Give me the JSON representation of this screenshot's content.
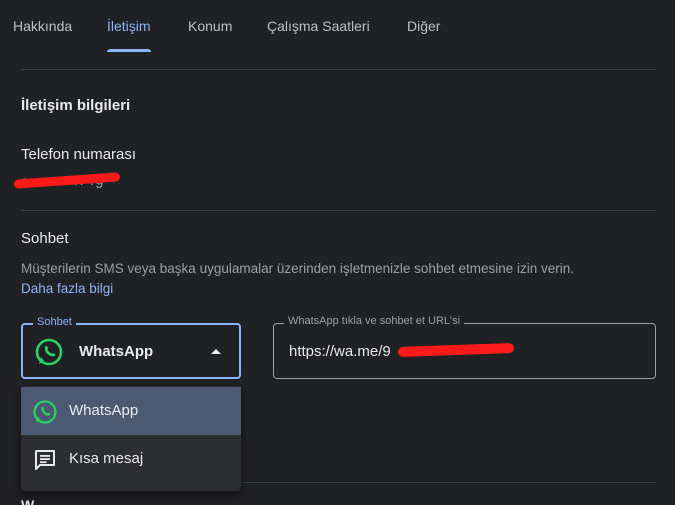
{
  "tabs": [
    {
      "label": "Hakkında"
    },
    {
      "label": "İletişim"
    },
    {
      "label": "Konum"
    },
    {
      "label": "Çalışma Saatleri"
    },
    {
      "label": "Diğer"
    }
  ],
  "active_tab": "İletişim",
  "contact": {
    "section_title": "İletişim bilgileri",
    "phone_label": "Telefon numarası",
    "phone_value": "0··· ··· ·· ·9"
  },
  "chat": {
    "title": "Sohbet",
    "description": "Müşterilerin SMS veya başka uygulamalar üzerinden işletmenizle sohbet etmesine izin verin.",
    "learn_more": "Daha fazla bilgi",
    "select_legend": "Sohbet",
    "selected_value": "WhatsApp",
    "url_legend": "WhatsApp tıkla ve sohbet et URL'si",
    "url_value": "https://wa.me/9",
    "options": [
      {
        "label": "WhatsApp",
        "icon": "whatsapp-icon"
      },
      {
        "label": "Kısa mesaj",
        "icon": "message-icon"
      }
    ]
  },
  "partial_link": "il",
  "partial_heading": "W",
  "colors": {
    "accent": "#8ab4f8",
    "whatsapp": "#25d366",
    "background": "#202124",
    "menu_selected": "#4b5a72"
  }
}
